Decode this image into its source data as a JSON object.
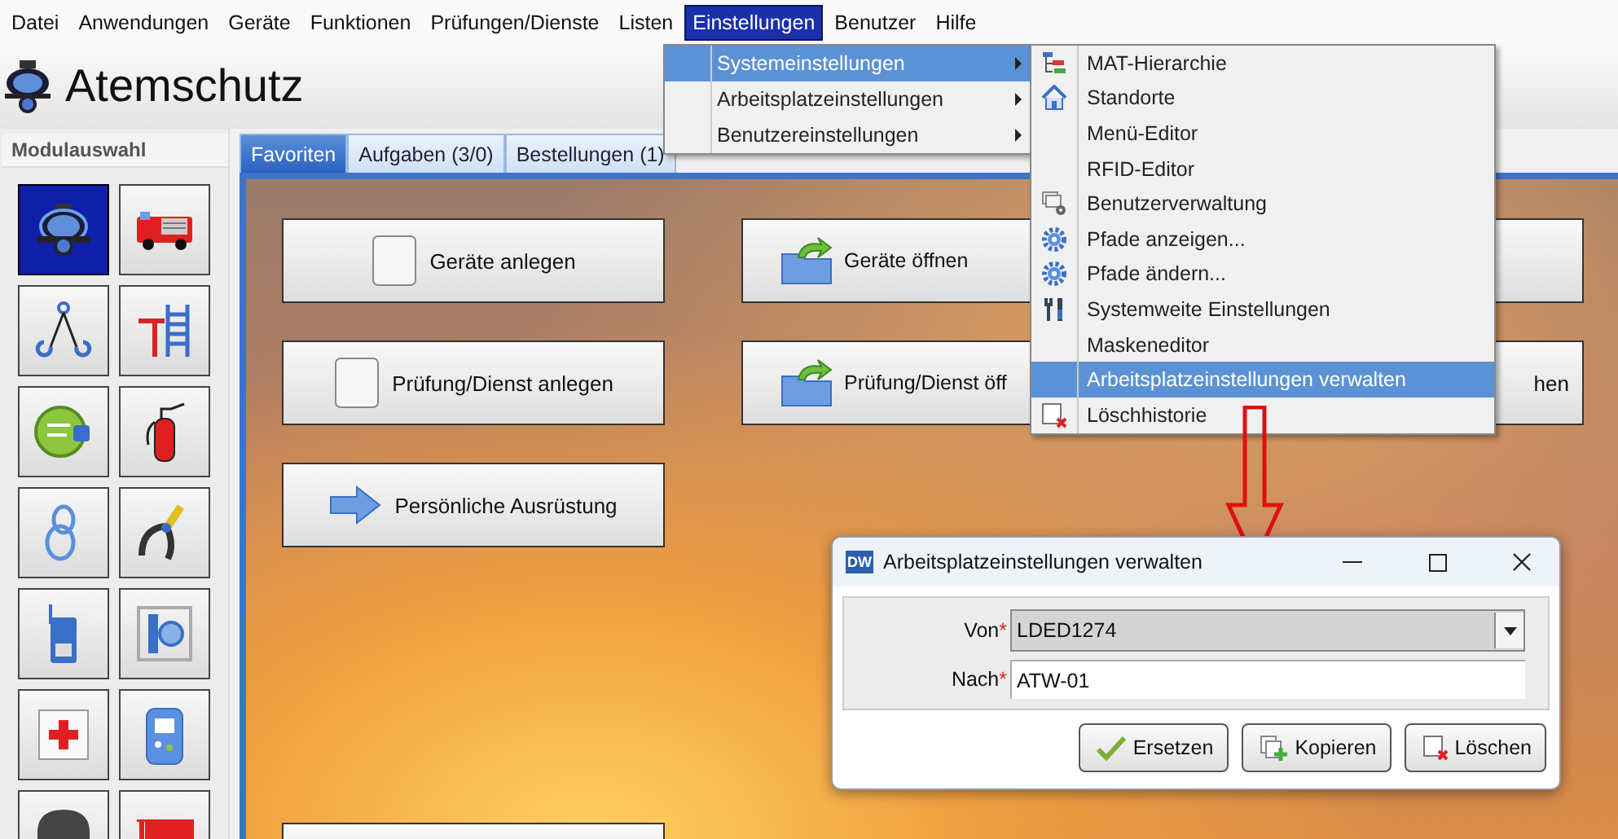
{
  "menubar": [
    {
      "label": "Datei",
      "selected": false
    },
    {
      "label": "Anwendungen",
      "selected": false
    },
    {
      "label": "Geräte",
      "selected": false
    },
    {
      "label": "Funktionen",
      "selected": false
    },
    {
      "label": "Prüfungen/Dienste",
      "selected": false
    },
    {
      "label": "Listen",
      "selected": false
    },
    {
      "label": "Einstellungen",
      "selected": true
    },
    {
      "label": "Benutzer",
      "selected": false
    },
    {
      "label": "Hilfe",
      "selected": false
    }
  ],
  "header": {
    "title": "Atemschutz"
  },
  "sidebar": {
    "title": "Modulauswahl",
    "modules": [
      {
        "selected": true
      },
      {
        "selected": false
      },
      {
        "selected": false
      },
      {
        "selected": false
      },
      {
        "selected": false
      },
      {
        "selected": false
      },
      {
        "selected": false
      },
      {
        "selected": false
      },
      {
        "selected": false
      },
      {
        "selected": false
      },
      {
        "selected": false
      },
      {
        "selected": false
      },
      {
        "selected": false
      },
      {
        "selected": false
      }
    ]
  },
  "tabs": [
    {
      "label": "Favoriten",
      "selected": true
    },
    {
      "label": "Aufgaben (3/0)",
      "selected": false
    },
    {
      "label": "Bestellungen (1)",
      "selected": false
    }
  ],
  "favorites": {
    "columns": [
      {
        "buttons": [
          {
            "kind": "create",
            "label": "Geräte anlegen"
          },
          {
            "kind": "create",
            "label": "Prüfung/Dienst anlegen"
          },
          {
            "kind": "navigate",
            "label": "Persönliche Ausrüstung"
          },
          {
            "kind": "plain"
          }
        ]
      },
      {
        "buttons": [
          {
            "kind": "open",
            "label": "Geräte öffnen"
          },
          {
            "kind": "open",
            "label": "Prüfung/Dienst öff"
          }
        ]
      },
      {
        "buttons": [
          {
            "kind": "plain"
          },
          {
            "kind": "plain",
            "label": "hen"
          }
        ]
      }
    ]
  },
  "menu": {
    "items": [
      {
        "label": "Systemeinstellungen",
        "selected": true
      },
      {
        "label": "Arbeitsplatzeinstellungen",
        "selected": false
      },
      {
        "label": "Benutzereinstellungen",
        "selected": false
      }
    ],
    "submenu": [
      {
        "label": "MAT-Hierarchie",
        "selected": false
      },
      {
        "label": "Standorte",
        "selected": false
      },
      {
        "label": "Menü-Editor",
        "selected": false
      },
      {
        "label": "RFID-Editor",
        "selected": false
      },
      {
        "label": "Benutzerverwaltung",
        "selected": false
      },
      {
        "label": "Pfade anzeigen...",
        "selected": false
      },
      {
        "label": "Pfade ändern...",
        "selected": false
      },
      {
        "label": "Systemweite Einstellungen",
        "selected": false
      },
      {
        "label": "Maskeneditor",
        "selected": false
      },
      {
        "label": "Arbeitsplatzeinstellungen verwalten",
        "selected": true
      },
      {
        "label": "Löschhistorie",
        "selected": false
      }
    ]
  },
  "dialog": {
    "logo": "DW",
    "title": "Arbeitsplatzeinstellungen verwalten",
    "fields": [
      {
        "kind": "combo",
        "label": "Von",
        "mark": "*",
        "value": "LDED1274"
      },
      {
        "kind": "text",
        "label": "Nach",
        "mark": "*",
        "value": "ATW-01"
      }
    ],
    "buttons": [
      {
        "kind": "replace",
        "label": "Ersetzen"
      },
      {
        "kind": "copy",
        "label": "Kopieren"
      },
      {
        "kind": "delete",
        "label": "Löschen"
      }
    ]
  }
}
